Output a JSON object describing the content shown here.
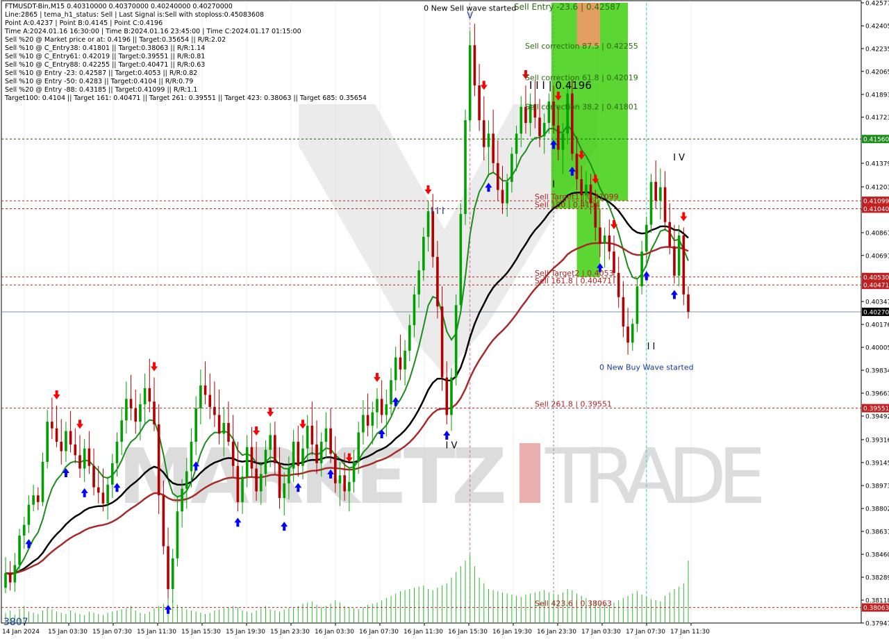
{
  "header": {
    "lines": [
      "FTMUSDT-Bin,M15  0.40310000 0.40370000 0.40240000 0.40270000",
      "Line:2865 | tema_h1_status: Sell | Last Signal is:Sell with stoploss:0.45083608",
      "Point A:0.4237 | Point B:0.4145 | Point C:0.4196",
      "Time A:2024.01.16 16:30:00 | Time B:2024.01.16 23:45:00 | Time C:2024.01.17 01:15:00",
      "Sell %20 @ Market price or at: 0.4196 || Target:0.35654 || R/R:2.02",
      "Sell %10 @ C_Entry38: 0.41801 || Target:0.38063 || R/R:1.14",
      "Sell %10 @ C_Entry61: 0.42019 || Target:0.39551 || R/R:0.81",
      "Sell %10 @ C_Entry88: 0.42255 || Target:0.40471 || R/R:0.63",
      "Sell %10 @ Entry -23: 0.42587 || Target:0.4053 || R/R:0.82",
      "Sell %10 @ Entry -50: 0.4283 || Target:0.4104 || R/R:0.79",
      "Sell %20 @ Entry -88: 0.43185 || Target:0.41099 || R/R:1.1",
      "Target100: 0.4104 || Target 161: 0.40471 || Target 261: 0.39551 || Target 423: 0.38063 || Target 685: 0.35654"
    ]
  },
  "watermark": {
    "left": "MARKETZ",
    "mid": "I",
    "right": "TRADE"
  },
  "colors": {
    "bull": "#00a000",
    "bear": "#b00000",
    "green_ma": "#1a8c1a",
    "black_ma": "#000000",
    "red_ma": "#a52a2a",
    "zone_green": "#33cc00",
    "zone_orange": "#e09a58",
    "target_line": "#b22222",
    "green_line": "#006400",
    "arrow_up": "#0000ff",
    "arrow_down": "#ff0000",
    "volume": "#2db82d",
    "current_price_bg": "#000000"
  },
  "chart_data": {
    "type": "candlestick",
    "symbol": "FTMUSDT-Bin",
    "timeframe": "M15",
    "ylim": [
      0.37947,
      0.42577
    ],
    "price_ticks": [
      "0.42577",
      "0.42405",
      "0.42235",
      "0.42065",
      "0.41893",
      "0.41723",
      "0.41379",
      "0.41203",
      "0.41033",
      "0.40861",
      "0.40691",
      "0.40347",
      "0.40176",
      "0.40005",
      "0.39834",
      "0.39663",
      "0.39492",
      "0.39316",
      "0.39145",
      "0.38973",
      "0.38802",
      "0.38631",
      "0.38460",
      "0.38289",
      "0.38118",
      "0.37947"
    ],
    "time_labels": [
      "14 Jan 2024",
      "15 Jan 03:30",
      "15 Jan 07:30",
      "15 Jan 11:30",
      "15 Jan 15:30",
      "15 Jan 19:30",
      "15 Jan 23:30",
      "16 Jan 03:30",
      "16 Jan 07:30",
      "16 Jan 11:30",
      "16 Jan 15:30",
      "16 Jan 19:30",
      "16 Jan 23:30",
      "17 Jan 03:30",
      "17 Jan 07:30",
      "17 Jan 11:30"
    ],
    "current_price": "0.40270",
    "price_tags": [
      {
        "value": "0.41560",
        "kind": "green"
      },
      {
        "value": "0.41099",
        "kind": "red"
      },
      {
        "value": "0.41040",
        "kind": "red"
      },
      {
        "value": "0.40530",
        "kind": "red"
      },
      {
        "value": "0.40471",
        "kind": "red"
      },
      {
        "value": "0.39551",
        "kind": "red"
      },
      {
        "value": "0.38063",
        "kind": "red"
      }
    ],
    "level_labels": [
      {
        "text": "Sell Target1 | 0.41099",
        "price": 0.41099,
        "color": "#b22222"
      },
      {
        "text": "Sell 100 | 0.4104",
        "price": 0.4104,
        "color": "#b22222"
      },
      {
        "text": "Sell Target2 | 0.4053",
        "price": 0.4053,
        "color": "#b22222"
      },
      {
        "text": "Sell 161.8 | 0.40471",
        "price": 0.40471,
        "color": "#b22222"
      },
      {
        "text": "Sell  261.8 | 0.39551",
        "price": 0.39551,
        "color": "#b22222"
      },
      {
        "text": "Sell  423.6 | 0.38063",
        "price": 0.38063,
        "color": "#b22222"
      }
    ],
    "zone_labels": [
      {
        "text": "Sell Entry -23.6 | 0.42587",
        "price": 0.42587
      },
      {
        "text": "Sell correction 87.5 | 0.42255",
        "price": 0.42255
      },
      {
        "text": "Sell correction 61.8 | 0.42019",
        "price": 0.42019
      },
      {
        "text": "Sell correction 38.2 | 0.41801",
        "price": 0.41801
      }
    ],
    "point_c_label": "I I I | 0.4196",
    "wave_labels": [
      {
        "text": "0 New Sell wave started",
        "bar": 100,
        "price": 0.4258
      },
      {
        "text": "0 New Buy Wave started",
        "bar": 138,
        "price": 0.399
      }
    ],
    "roman_labels": [
      {
        "text": "V",
        "bar": 100,
        "price": 0.4246
      },
      {
        "text": "I I I",
        "bar": 93,
        "price": 0.41
      },
      {
        "text": "I V",
        "bar": 96,
        "price": 0.3925
      },
      {
        "text": "I V",
        "bar": 145,
        "price": 0.414
      },
      {
        "text": "I I",
        "bar": 139,
        "price": 0.3999
      },
      {
        "text": "I",
        "bar": 118,
        "price": 0.412
      }
    ],
    "bottom_left_label": "3807",
    "candles": [
      [
        0.3821,
        0.3844,
        0.3817,
        0.3832
      ],
      [
        0.3832,
        0.3841,
        0.3819,
        0.3825
      ],
      [
        0.3825,
        0.3847,
        0.3818,
        0.3838
      ],
      [
        0.3838,
        0.3865,
        0.3833,
        0.386
      ],
      [
        0.386,
        0.3874,
        0.385,
        0.3868
      ],
      [
        0.3868,
        0.389,
        0.3862,
        0.3883
      ],
      [
        0.3883,
        0.3898,
        0.3878,
        0.389
      ],
      [
        0.389,
        0.3896,
        0.3879,
        0.3885
      ],
      [
        0.3885,
        0.3922,
        0.3882,
        0.3915
      ],
      [
        0.3915,
        0.3954,
        0.391,
        0.3945
      ],
      [
        0.3945,
        0.3963,
        0.3932,
        0.394
      ],
      [
        0.394,
        0.3957,
        0.3926,
        0.393
      ],
      [
        0.393,
        0.3947,
        0.3913,
        0.3923
      ],
      [
        0.3923,
        0.3945,
        0.3915,
        0.3938
      ],
      [
        0.3938,
        0.3953,
        0.3922,
        0.3928
      ],
      [
        0.3928,
        0.394,
        0.3914,
        0.392
      ],
      [
        0.392,
        0.3935,
        0.3903,
        0.391
      ],
      [
        0.391,
        0.3932,
        0.39,
        0.3925
      ],
      [
        0.3925,
        0.3938,
        0.3906,
        0.3912
      ],
      [
        0.3912,
        0.3925,
        0.389,
        0.3896
      ],
      [
        0.3896,
        0.3912,
        0.3884,
        0.3892
      ],
      [
        0.3892,
        0.391,
        0.3878,
        0.3884
      ],
      [
        0.3884,
        0.3904,
        0.3872,
        0.3898
      ],
      [
        0.3898,
        0.3921,
        0.3888,
        0.3914
      ],
      [
        0.3914,
        0.3937,
        0.3904,
        0.393
      ],
      [
        0.393,
        0.3956,
        0.392,
        0.3946
      ],
      [
        0.3946,
        0.3975,
        0.3936,
        0.3962
      ],
      [
        0.3962,
        0.398,
        0.3946,
        0.3955
      ],
      [
        0.3955,
        0.3969,
        0.3936,
        0.3945
      ],
      [
        0.3945,
        0.3966,
        0.3931,
        0.3958
      ],
      [
        0.3958,
        0.3981,
        0.3944,
        0.397
      ],
      [
        0.397,
        0.3992,
        0.3952,
        0.396
      ],
      [
        0.396,
        0.3978,
        0.3938,
        0.3943
      ],
      [
        0.3943,
        0.3958,
        0.3876,
        0.389
      ],
      [
        0.389,
        0.3901,
        0.3846,
        0.3852
      ],
      [
        0.3852,
        0.3866,
        0.3813,
        0.382
      ],
      [
        0.382,
        0.385,
        0.381,
        0.3843
      ],
      [
        0.3843,
        0.3889,
        0.3837,
        0.3878
      ],
      [
        0.3878,
        0.3902,
        0.3866,
        0.3895
      ],
      [
        0.3895,
        0.3918,
        0.388,
        0.3908
      ],
      [
        0.3908,
        0.394,
        0.3896,
        0.393
      ],
      [
        0.393,
        0.3964,
        0.392,
        0.3955
      ],
      [
        0.3955,
        0.3984,
        0.3943,
        0.3972
      ],
      [
        0.3972,
        0.399,
        0.3958,
        0.3965
      ],
      [
        0.3965,
        0.3981,
        0.3947,
        0.3956
      ],
      [
        0.3956,
        0.3975,
        0.3941,
        0.395
      ],
      [
        0.395,
        0.3969,
        0.3928,
        0.3936
      ],
      [
        0.3936,
        0.3956,
        0.3919,
        0.3944
      ],
      [
        0.3944,
        0.396,
        0.3927,
        0.393
      ],
      [
        0.393,
        0.395,
        0.3904,
        0.3912
      ],
      [
        0.3912,
        0.393,
        0.3878,
        0.3885
      ],
      [
        0.3885,
        0.3912,
        0.3876,
        0.3904
      ],
      [
        0.3904,
        0.3935,
        0.3896,
        0.3926
      ],
      [
        0.3926,
        0.3941,
        0.3904,
        0.391
      ],
      [
        0.391,
        0.393,
        0.3886,
        0.3893
      ],
      [
        0.3893,
        0.3915,
        0.3883,
        0.3906
      ],
      [
        0.3906,
        0.3931,
        0.3897,
        0.3924
      ],
      [
        0.3924,
        0.3944,
        0.3911,
        0.3935
      ],
      [
        0.3935,
        0.3945,
        0.3906,
        0.3914
      ],
      [
        0.3914,
        0.3926,
        0.388,
        0.3888
      ],
      [
        0.3888,
        0.3907,
        0.3875,
        0.3899
      ],
      [
        0.3899,
        0.3919,
        0.3887,
        0.391
      ],
      [
        0.391,
        0.3939,
        0.39,
        0.393
      ],
      [
        0.393,
        0.3942,
        0.3904,
        0.3912
      ],
      [
        0.3912,
        0.3935,
        0.3902,
        0.3925
      ],
      [
        0.3925,
        0.395,
        0.3915,
        0.3942
      ],
      [
        0.3942,
        0.396,
        0.392,
        0.3928
      ],
      [
        0.3928,
        0.3946,
        0.3906,
        0.3914
      ],
      [
        0.3914,
        0.3937,
        0.3904,
        0.393
      ],
      [
        0.393,
        0.3952,
        0.3918,
        0.394
      ],
      [
        0.394,
        0.3955,
        0.3914,
        0.3921
      ],
      [
        0.3921,
        0.3934,
        0.3892,
        0.3899
      ],
      [
        0.3899,
        0.3915,
        0.3882,
        0.3905
      ],
      [
        0.3905,
        0.3922,
        0.3886,
        0.3893
      ],
      [
        0.3893,
        0.391,
        0.3878,
        0.39
      ],
      [
        0.39,
        0.3924,
        0.3892,
        0.3915
      ],
      [
        0.3915,
        0.3945,
        0.3906,
        0.3937
      ],
      [
        0.3937,
        0.3961,
        0.3928,
        0.395
      ],
      [
        0.395,
        0.3966,
        0.3934,
        0.3942
      ],
      [
        0.3942,
        0.396,
        0.3928,
        0.3952
      ],
      [
        0.3952,
        0.397,
        0.394,
        0.3962
      ],
      [
        0.3962,
        0.3976,
        0.3944,
        0.395
      ],
      [
        0.395,
        0.3969,
        0.3934,
        0.3958
      ],
      [
        0.3958,
        0.3985,
        0.395,
        0.3976
      ],
      [
        0.3976,
        0.4001,
        0.3968,
        0.3993
      ],
      [
        0.3993,
        0.401,
        0.3976,
        0.3984
      ],
      [
        0.3984,
        0.4006,
        0.3972,
        0.3998
      ],
      [
        0.3998,
        0.4025,
        0.399,
        0.4017
      ],
      [
        0.4017,
        0.4046,
        0.4008,
        0.404
      ],
      [
        0.404,
        0.4065,
        0.403,
        0.4058
      ],
      [
        0.4058,
        0.409,
        0.405,
        0.4083
      ],
      [
        0.4083,
        0.411,
        0.4072,
        0.4102
      ],
      [
        0.4102,
        0.4115,
        0.406,
        0.4068
      ],
      [
        0.4068,
        0.408,
        0.4022,
        0.4031
      ],
      [
        0.4031,
        0.4046,
        0.3968,
        0.3978
      ],
      [
        0.3978,
        0.399,
        0.3943,
        0.395
      ],
      [
        0.395,
        0.3985,
        0.3938,
        0.3978
      ],
      [
        0.3978,
        0.404,
        0.3972,
        0.4032
      ],
      [
        0.4032,
        0.4108,
        0.4025,
        0.41
      ],
      [
        0.41,
        0.4178,
        0.4092,
        0.417
      ],
      [
        0.417,
        0.4237,
        0.4162,
        0.4226
      ],
      [
        0.4226,
        0.4242,
        0.4188,
        0.4196
      ],
      [
        0.4196,
        0.4212,
        0.4162,
        0.417
      ],
      [
        0.417,
        0.4188,
        0.414,
        0.415
      ],
      [
        0.415,
        0.417,
        0.4128,
        0.416
      ],
      [
        0.416,
        0.4178,
        0.4131,
        0.4138
      ],
      [
        0.4138,
        0.4155,
        0.411,
        0.4118
      ],
      [
        0.4118,
        0.4136,
        0.41,
        0.4108
      ],
      [
        0.4108,
        0.413,
        0.4098,
        0.4124
      ],
      [
        0.4124,
        0.415,
        0.4116,
        0.4145
      ],
      [
        0.4145,
        0.4166,
        0.4132,
        0.416
      ],
      [
        0.416,
        0.4188,
        0.415,
        0.418
      ],
      [
        0.418,
        0.4196,
        0.416,
        0.4168
      ],
      [
        0.4168,
        0.419,
        0.4158,
        0.4182
      ],
      [
        0.4182,
        0.42,
        0.4164,
        0.4172
      ],
      [
        0.4172,
        0.4186,
        0.415,
        0.4158
      ],
      [
        0.4158,
        0.4175,
        0.4145,
        0.4168
      ],
      [
        0.4168,
        0.419,
        0.416,
        0.4184
      ],
      [
        0.4184,
        0.4196,
        0.416,
        0.4166
      ],
      [
        0.4166,
        0.418,
        0.414,
        0.4148
      ],
      [
        0.4148,
        0.4168,
        0.413,
        0.416
      ],
      [
        0.416,
        0.4198,
        0.4152,
        0.419
      ],
      [
        0.419,
        0.42,
        0.414,
        0.4145
      ],
      [
        0.4145,
        0.4158,
        0.4118,
        0.4126
      ],
      [
        0.4126,
        0.4136,
        0.4104,
        0.4114
      ],
      [
        0.4114,
        0.4132,
        0.4106,
        0.4122
      ],
      [
        0.4122,
        0.413,
        0.41,
        0.4108
      ],
      [
        0.4108,
        0.4118,
        0.408,
        0.409
      ],
      [
        0.409,
        0.4104,
        0.4068,
        0.4078
      ],
      [
        0.4078,
        0.409,
        0.406,
        0.4084
      ],
      [
        0.4084,
        0.4096,
        0.4066,
        0.4072
      ],
      [
        0.4072,
        0.4084,
        0.4048,
        0.4056
      ],
      [
        0.4056,
        0.4068,
        0.403,
        0.4038
      ],
      [
        0.4038,
        0.405,
        0.4008,
        0.4016
      ],
      [
        0.4016,
        0.403,
        0.3995,
        0.4004
      ],
      [
        0.4004,
        0.4022,
        0.3998,
        0.4018
      ],
      [
        0.4018,
        0.4052,
        0.4012,
        0.4046
      ],
      [
        0.4046,
        0.408,
        0.404,
        0.4072
      ],
      [
        0.4072,
        0.4098,
        0.4062,
        0.4092
      ],
      [
        0.4092,
        0.413,
        0.4086,
        0.4124
      ],
      [
        0.4124,
        0.414,
        0.4104,
        0.411
      ],
      [
        0.411,
        0.4134,
        0.4096,
        0.412
      ],
      [
        0.412,
        0.4132,
        0.4088,
        0.4094
      ],
      [
        0.4094,
        0.4108,
        0.407,
        0.4076
      ],
      [
        0.4076,
        0.4092,
        0.4048,
        0.4054
      ],
      [
        0.4054,
        0.4092,
        0.4046,
        0.4084
      ],
      [
        0.4084,
        0.409,
        0.4032,
        0.404
      ],
      [
        0.404,
        0.4046,
        0.4022,
        0.4027
      ]
    ],
    "volume": [
      18,
      22,
      15,
      25,
      30,
      20,
      18,
      16,
      22,
      28,
      24,
      20,
      18,
      16,
      22,
      18,
      16,
      14,
      20,
      18,
      16,
      14,
      18,
      20,
      22,
      24,
      26,
      30,
      22,
      18,
      16,
      20,
      26,
      30,
      34,
      44,
      40,
      32,
      28,
      24,
      22,
      20,
      18,
      16,
      18,
      22,
      24,
      26,
      28,
      30,
      28,
      22,
      20,
      18,
      22,
      26,
      30,
      24,
      22,
      20,
      24,
      26,
      28,
      30,
      34,
      36,
      38,
      32,
      28,
      30,
      34,
      40,
      36,
      30,
      28,
      26,
      24,
      28,
      32,
      34,
      36,
      40,
      44,
      48,
      52,
      56,
      58,
      60,
      62,
      64,
      66,
      60,
      58,
      62,
      66,
      70,
      80,
      90,
      100,
      110,
      120,
      100,
      80,
      70,
      60,
      58,
      56,
      54,
      52,
      50,
      48,
      46,
      50,
      52,
      54,
      56,
      58,
      54,
      52,
      50,
      54,
      60,
      58,
      52,
      48,
      44,
      40,
      38,
      36,
      34,
      32,
      36,
      40,
      44,
      48,
      52,
      56,
      50,
      46,
      42,
      40,
      38,
      48,
      54,
      60,
      64,
      70,
      110
    ]
  }
}
